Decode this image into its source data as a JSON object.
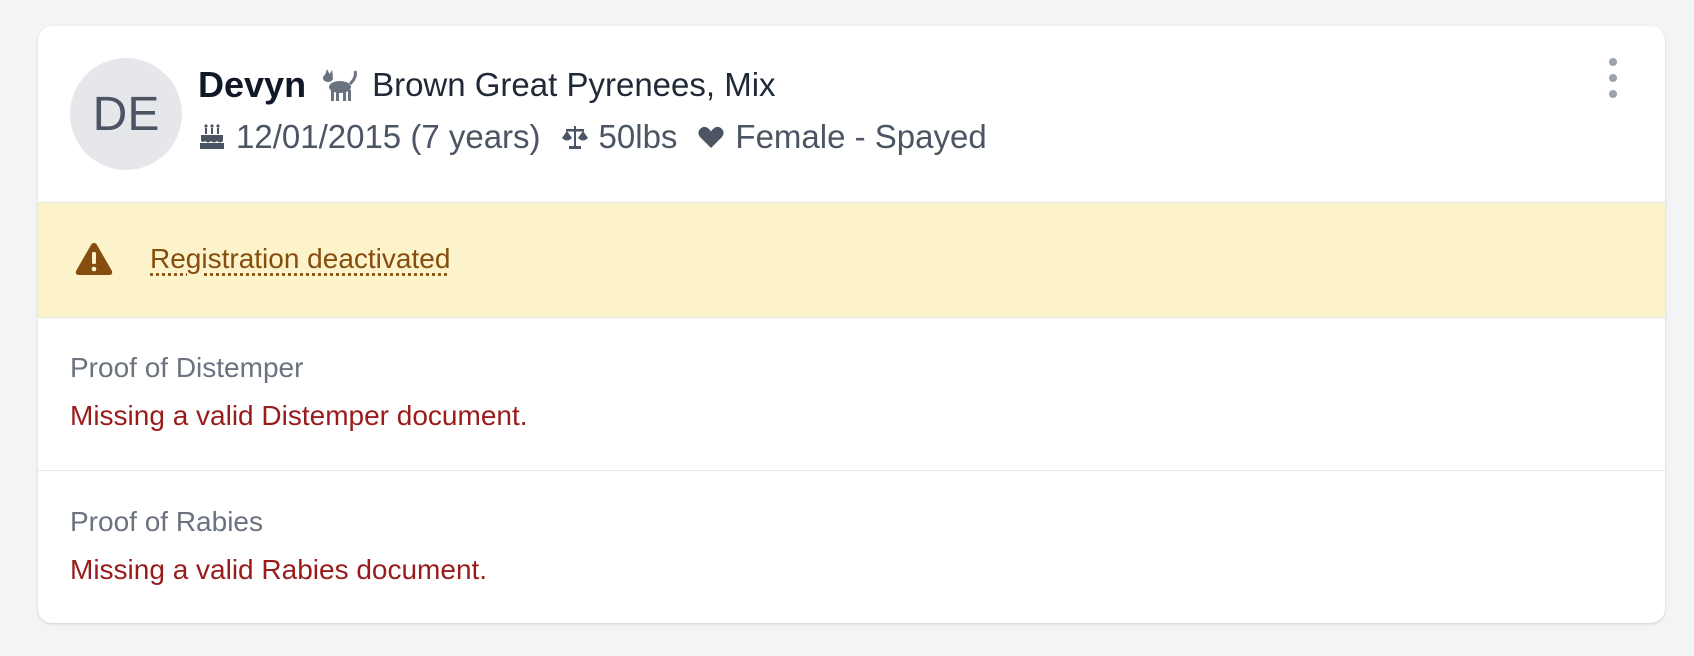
{
  "pet": {
    "initials": "DE",
    "name": "Devyn",
    "species_icon": "dog-icon",
    "breed": "Brown Great Pyrenees, Mix",
    "birthdate": "12/01/2015 (7 years)",
    "weight": "50lbs",
    "sex": "Female - Spayed"
  },
  "alert": {
    "icon": "warning-triangle-icon",
    "text": "Registration deactivated",
    "color": "#854d0e",
    "background": "#fcf3cb"
  },
  "requirements": [
    {
      "title": "Proof of Distemper",
      "message": "Missing a valid Distemper document."
    },
    {
      "title": "Proof of Rabies",
      "message": "Missing a valid Rabies document."
    }
  ],
  "colors": {
    "error_text": "#991b1b",
    "muted_text": "#6b7280",
    "page_background": "#f3f4f6"
  }
}
